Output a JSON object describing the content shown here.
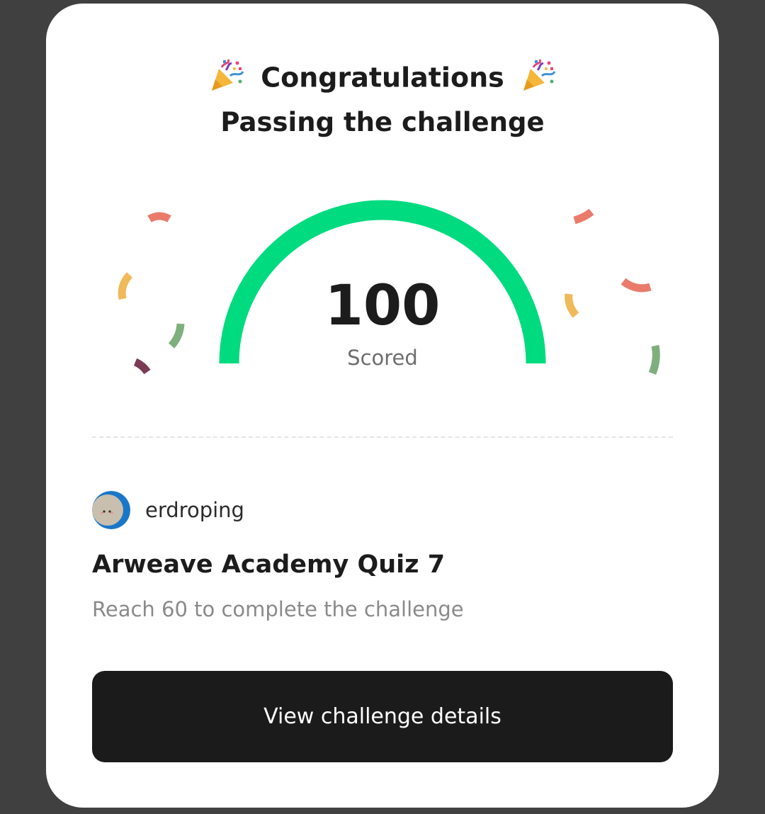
{
  "header": {
    "title": "Congratulations",
    "subtitle": "Passing the challenge",
    "party_icon": "party-popper-icon"
  },
  "score": {
    "value": "100",
    "label": "Scored",
    "fraction": 1.0
  },
  "challenge": {
    "author": "erdroping",
    "title": "Arweave Academy Quiz 7",
    "description": "Reach 60 to complete the challenge"
  },
  "actions": {
    "view_details_label": "View challenge details"
  },
  "colors": {
    "gauge": "#00db80",
    "button_bg": "#1b1b1b",
    "confetti_red": "#ea7b6b",
    "confetti_yellow": "#f0b95a",
    "confetti_green": "#7faf7d",
    "confetti_purple": "#7a3b55"
  }
}
